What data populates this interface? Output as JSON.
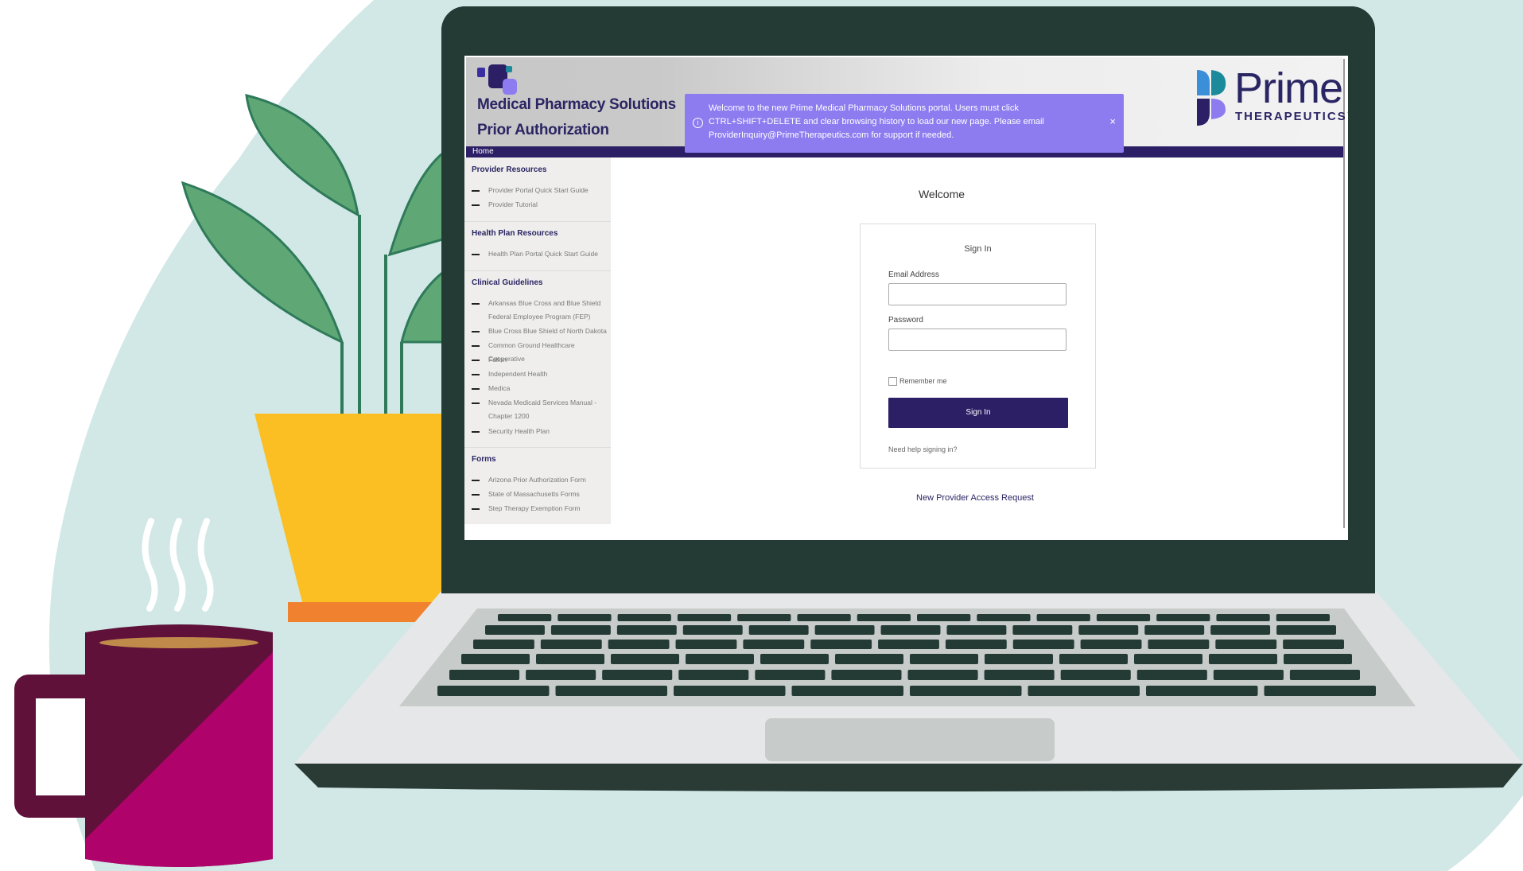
{
  "header": {
    "title_line1": "Medical Pharmacy Solutions",
    "title_line2": "Prior Authorization",
    "brand_name": "Prime",
    "brand_sub": "THERAPEUTICS™"
  },
  "nav": {
    "home": "Home"
  },
  "banner": {
    "text": "Welcome to the new Prime Medical Pharmacy Solutions portal. Users must click CTRL+SHIFT+DELETE and clear browsing history to load our new page. Please email ProviderInquiry@PrimeTherapeutics.com for support if needed.",
    "close": "×"
  },
  "sidebar": {
    "provider_resources": {
      "heading": "Provider Resources",
      "items": [
        "Provider Portal Quick Start Guide",
        "Provider Tutorial"
      ]
    },
    "health_plan_resources": {
      "heading": "Health Plan Resources",
      "items": [
        "Health Plan Portal Quick Start Guide"
      ]
    },
    "clinical_guidelines": {
      "heading": "Clinical Guidelines",
      "items": [
        "Arkansas Blue Cross and Blue Shield Federal Employee Program (FEP)",
        "Blue Cross Blue Shield of North Dakota",
        "Common Ground Healthcare Cooperative",
        "Fallon",
        "Independent Health",
        "Medica",
        "Nevada Medicaid Services Manual - Chapter 1200",
        "Security Health Plan"
      ]
    },
    "forms": {
      "heading": "Forms",
      "items": [
        "Arizona Prior Authorization Form",
        "State of Massachusetts Forms",
        "Step Therapy Exemption Form"
      ]
    }
  },
  "main": {
    "welcome": "Welcome",
    "card_title": "Sign In",
    "email_label": "Email Address",
    "email_value": "",
    "password_label": "Password",
    "password_value": "",
    "remember_label": "Remember me",
    "signin_button": "Sign In",
    "help_link": "Need help signing in?",
    "new_provider_link": "New Provider Access Request"
  },
  "colors": {
    "brand_navy": "#2c1f66",
    "banner_purple": "#8c7cf0",
    "background_teal": "#d1e8e6",
    "bezel": "#243b35"
  }
}
